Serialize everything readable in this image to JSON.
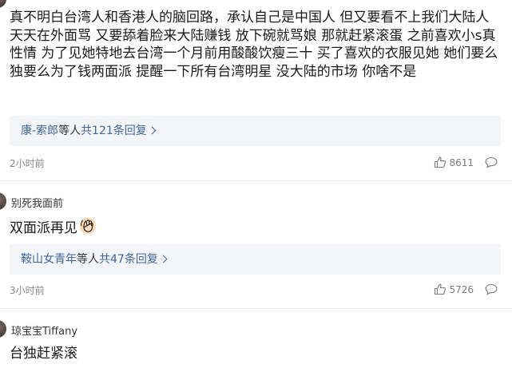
{
  "comments": [
    {
      "username": "",
      "text": "真不明白台湾人和香港人的脑回路，承认自己是中国人 但又要看不上我们大陆人 天天在外面骂 又要舔着脸来大陆赚钱 放下碗就骂娘 那就赶紧滚蛋 之前喜欢小s真性情 为了见她特地去台湾一个月前用酸酸饮瘦三十 买了喜欢的衣服见她 她们要么独要么为了钱两面派 提醒一下所有台湾明星 没大陆的市场 你啥不是",
      "reply_users": "康-索郎",
      "reply_mid": "等人",
      "reply_count": "共121条回复",
      "time": "2小时前",
      "likes": "8611"
    },
    {
      "username": "别死我面前",
      "text": "双面派再见",
      "emoji": "waving-hand-emoji",
      "reply_users": "鞍山女青年",
      "reply_mid": "等人",
      "reply_count": "共47条回复",
      "time": "3小时前",
      "likes": "5726"
    },
    {
      "username": "琼宝宝Tiffany",
      "text": "台独赶紧滚"
    }
  ],
  "colors": {
    "link": "#406599",
    "reply_bg": "#f3f5f9",
    "muted": "#888888"
  }
}
